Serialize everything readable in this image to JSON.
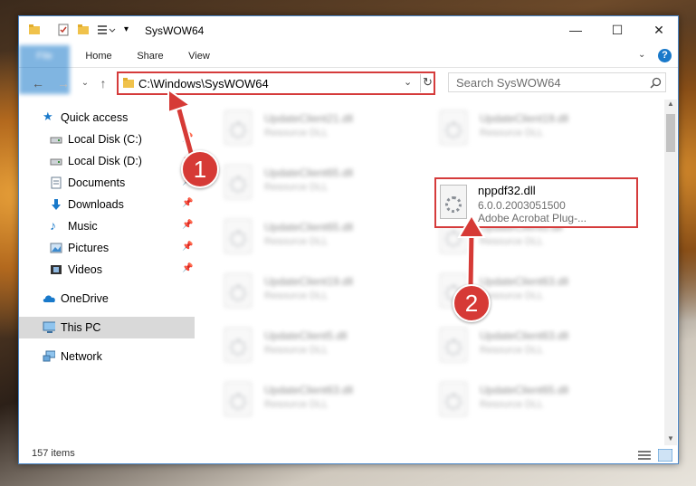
{
  "window": {
    "title": "SysWOW64"
  },
  "ribbon": {
    "tabs": [
      "File",
      "Home",
      "Share",
      "View"
    ]
  },
  "address": {
    "path": "C:\\Windows\\SysWOW64"
  },
  "search": {
    "placeholder": "Search SysWOW64"
  },
  "sidebar": {
    "items": [
      {
        "label": "Quick access",
        "icon": "star-icon",
        "pinned": false
      },
      {
        "label": "Local Disk (C:)",
        "icon": "drive-icon",
        "pinned": true
      },
      {
        "label": "Local Disk (D:)",
        "icon": "drive-icon",
        "pinned": true
      },
      {
        "label": "Documents",
        "icon": "documents-icon",
        "pinned": true
      },
      {
        "label": "Downloads",
        "icon": "download-icon",
        "pinned": true
      },
      {
        "label": "Music",
        "icon": "music-icon",
        "pinned": true
      },
      {
        "label": "Pictures",
        "icon": "pictures-icon",
        "pinned": true
      },
      {
        "label": "Videos",
        "icon": "videos-icon",
        "pinned": true
      },
      {
        "label": "OneDrive",
        "icon": "cloud-icon",
        "pinned": false
      },
      {
        "label": "This PC",
        "icon": "pc-icon",
        "pinned": false,
        "selected": true
      },
      {
        "label": "Network",
        "icon": "network-icon",
        "pinned": false
      }
    ]
  },
  "files": [
    {
      "name": "UpdateClient21.dll",
      "type": "Resource DLL"
    },
    {
      "name": "UpdateClient19.dll",
      "type": "Resource DLL"
    },
    {
      "name": "UpdateClient65.dll",
      "type": "Resource DLL"
    },
    {
      "name": "UpdateClient65.dll",
      "type": "Resource DLL"
    },
    {
      "name": "UpdateClient5.dll",
      "type": "Resource DLL"
    },
    {
      "name": "UpdateClient19.dll",
      "type": "Resource DLL"
    },
    {
      "name": "UpdateClient63.dll",
      "type": "Resource DLL"
    },
    {
      "name": "UpdateClient5.dll",
      "type": "Resource DLL"
    },
    {
      "name": "UpdateClient63.dll",
      "type": "Resource DLL"
    },
    {
      "name": "UpdateClient63.dll",
      "type": "Resource DLL"
    },
    {
      "name": "UpdateClient65.dll",
      "type": "Resource DLL"
    }
  ],
  "highlighted_file": {
    "name": "nppdf32.dll",
    "version": "6.0.0.2003051500",
    "description": "Adobe Acrobat Plug-..."
  },
  "status": {
    "item_count": "157 items"
  },
  "annotations": {
    "step1": "1",
    "step2": "2"
  },
  "colors": {
    "accent": "#1979ca",
    "highlight": "#d53b3b",
    "selected": "#d9d9d9"
  }
}
